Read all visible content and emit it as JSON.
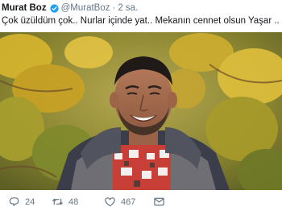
{
  "tweet": {
    "author_name": "Murat Boz",
    "handle": "@MuratBoz",
    "separator": "·",
    "time": "2 sa.",
    "text": "Çok üzüldüm çok.. Nurlar içinde yat.. Mekanın cennet olsun Yaşar ..",
    "verified": true
  },
  "actions": {
    "reply_count": "24",
    "retweet_count": "48",
    "like_count": "467"
  },
  "colors": {
    "verified_blue": "#1da1f2",
    "meta_gray": "#657786",
    "text": "#14171a"
  },
  "icons": [
    "verified-badge-icon",
    "reply-icon",
    "retweet-icon",
    "like-icon",
    "direct-message-icon"
  ]
}
